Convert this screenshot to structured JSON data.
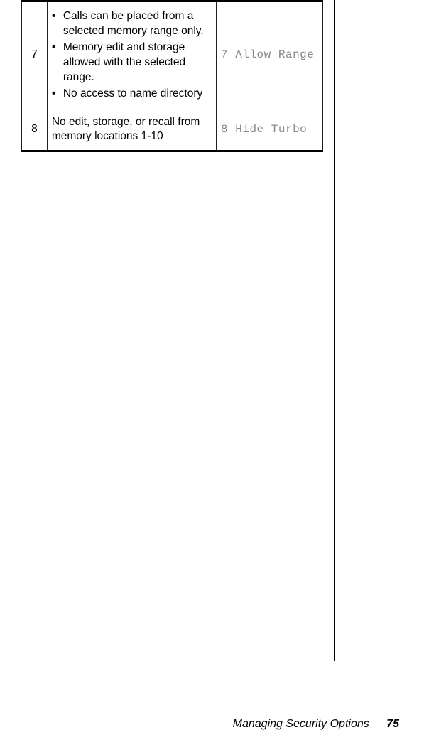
{
  "table": {
    "rows": [
      {
        "num": "7",
        "bullets": [
          "Calls can be placed from a selected memory range only.",
          "Memory edit and storage allowed with the selected range.",
          "No access to name directory"
        ],
        "display": "7 Allow Range"
      },
      {
        "num": "8",
        "desc": "No edit, storage, or recall from memory locations 1-10",
        "display": "8 Hide Turbo"
      }
    ]
  },
  "footer": {
    "title": "Managing Security Options",
    "page": "75"
  }
}
